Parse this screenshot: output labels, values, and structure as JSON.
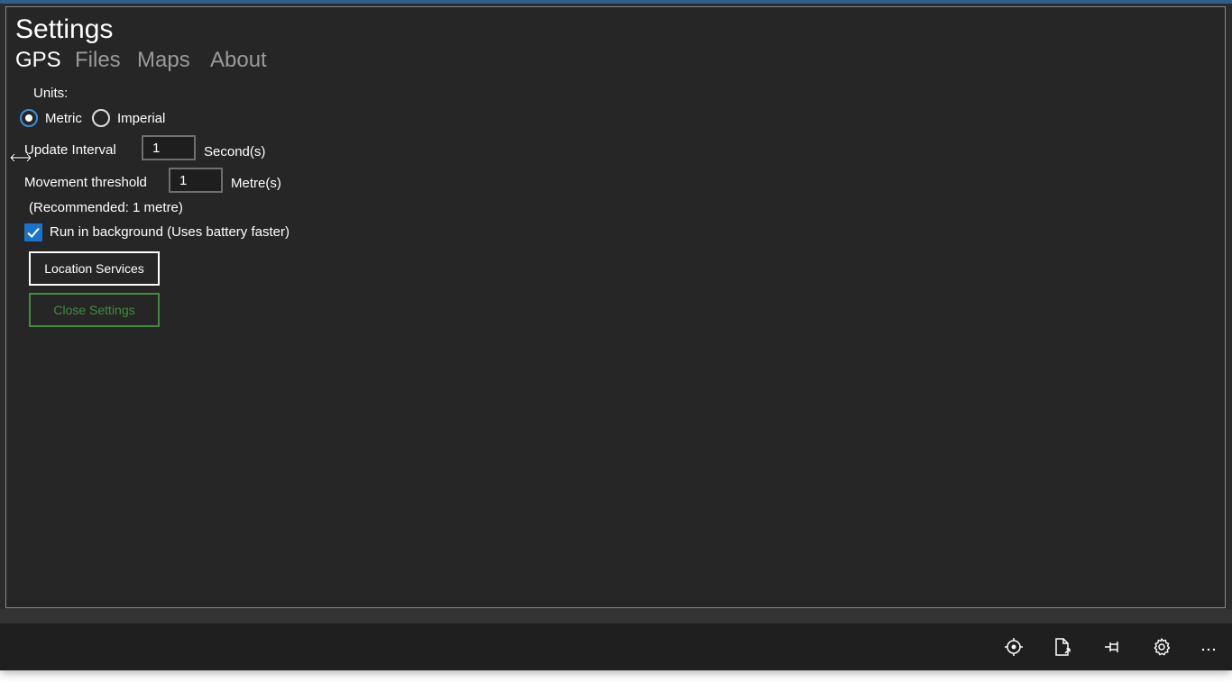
{
  "settings": {
    "title": "Settings",
    "tabs": [
      {
        "label": "GPS",
        "active": true
      },
      {
        "label": "Files",
        "active": false
      },
      {
        "label": "Maps",
        "active": false
      },
      {
        "label": "About",
        "active": false
      }
    ]
  },
  "gps": {
    "units_label": "Units:",
    "units_options": [
      {
        "label": "Metric",
        "selected": true
      },
      {
        "label": "Imperial",
        "selected": false
      }
    ],
    "update_interval": {
      "label": "Update Interval",
      "value": "1",
      "unit": "Second(s)"
    },
    "movement_threshold": {
      "label": "Movement threshold",
      "value": "1",
      "unit": "Metre(s)"
    },
    "recommendation": "(Recommended: 1 metre)",
    "run_in_background": {
      "label": "Run in background (Uses battery faster)",
      "checked": true
    },
    "location_services_button": "Location Services",
    "close_button": "Close Settings"
  },
  "appbar": {
    "icons": [
      "location-target-icon",
      "export-file-icon",
      "pin-icon",
      "gear-icon",
      "more-icon"
    ]
  },
  "colors": {
    "accent_blue": "#1a73c9",
    "close_green": "#3f8e3f",
    "background": "#262626"
  }
}
